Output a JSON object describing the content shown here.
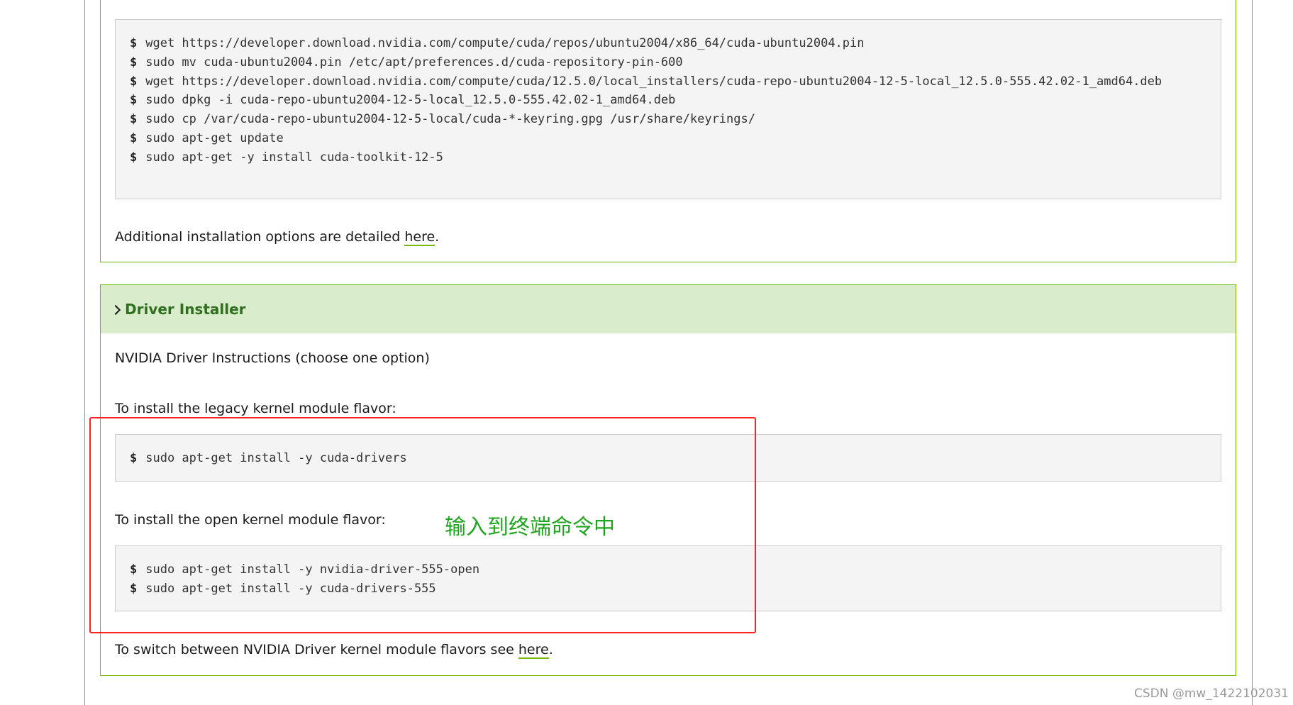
{
  "top_section": {
    "commands": [
      {
        "prompt": "$",
        "text": "wget https://developer.download.nvidia.com/compute/cuda/repos/ubuntu2004/x86_64/cuda-ubuntu2004.pin"
      },
      {
        "prompt": "$",
        "text": "sudo mv cuda-ubuntu2004.pin /etc/apt/preferences.d/cuda-repository-pin-600"
      },
      {
        "prompt": "$",
        "text": "wget https://developer.download.nvidia.com/compute/cuda/12.5.0/local_installers/cuda-repo-ubuntu2004-12-5-local_12.5.0-555.42.02-1_amd64.deb"
      },
      {
        "prompt": "$",
        "text": "sudo dpkg -i cuda-repo-ubuntu2004-12-5-local_12.5.0-555.42.02-1_amd64.deb"
      },
      {
        "prompt": "$",
        "text": "sudo cp /var/cuda-repo-ubuntu2004-12-5-local/cuda-*-keyring.gpg /usr/share/keyrings/"
      },
      {
        "prompt": "$",
        "text": "sudo apt-get update"
      },
      {
        "prompt": "$",
        "text": "sudo apt-get -y install cuda-toolkit-12-5"
      }
    ],
    "note_prefix": "Additional installation options are detailed ",
    "note_link": "here",
    "note_suffix": "."
  },
  "driver_section": {
    "header": "Driver Installer",
    "intro": "NVIDIA Driver Instructions (choose one option)",
    "legacy_label": "To install the legacy kernel module flavor:",
    "legacy_commands": [
      {
        "prompt": "$",
        "text": "sudo apt-get install -y cuda-drivers"
      }
    ],
    "open_label": "To install the open kernel module flavor:",
    "open_commands": [
      {
        "prompt": "$",
        "text": "sudo apt-get install -y nvidia-driver-555-open"
      },
      {
        "prompt": "$",
        "text": "sudo apt-get install -y cuda-drivers-555"
      }
    ],
    "switch_prefix": "To switch between NVIDIA Driver kernel module flavors see ",
    "switch_link": "here",
    "switch_suffix": "."
  },
  "annotation_text": "输入到终端命令中",
  "watermark": "CSDN @mw_1422102031",
  "colors": {
    "accent": "#76b900",
    "header_bg": "#d9edcc",
    "header_text": "#2f6f1f",
    "annotation": "#1fa51f",
    "highlight_box": "#ff2020"
  }
}
